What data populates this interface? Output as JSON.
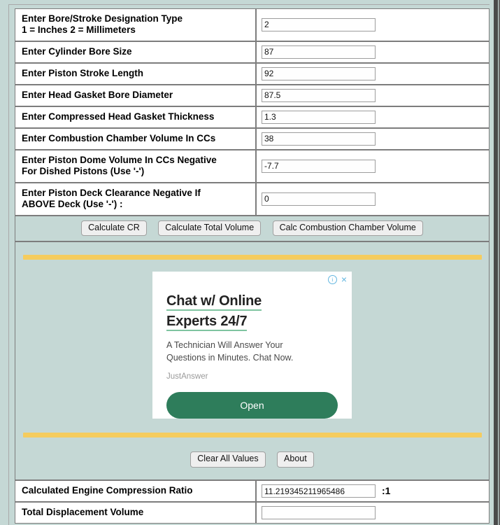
{
  "form": {
    "rows": [
      {
        "label": "Enter Bore/Stroke Designation Type\n1 = Inches 2 = Millimeters",
        "value": "2",
        "name": "bore-stroke-designation-type"
      },
      {
        "label": "Enter Cylinder Bore Size",
        "value": "87",
        "name": "cylinder-bore-size"
      },
      {
        "label": "Enter Piston Stroke Length",
        "value": "92",
        "name": "piston-stroke-length"
      },
      {
        "label": "Enter Head Gasket Bore Diameter",
        "value": "87.5",
        "name": "head-gasket-bore-diameter"
      },
      {
        "label": "Enter Compressed Head Gasket Thickness",
        "value": "1.3",
        "name": "compressed-head-gasket-thickness"
      },
      {
        "label": "Enter Combustion Chamber Volume In CCs",
        "value": "38",
        "name": "combustion-chamber-volume"
      },
      {
        "label": "Enter Piston Dome Volume In CCs Negative\nFor Dished Pistons (Use '-')",
        "value": "-7.7",
        "name": "piston-dome-volume"
      },
      {
        "label": "Enter Piston Deck Clearance Negative If\nABOVE Deck (Use '-') :",
        "value": "0",
        "name": "piston-deck-clearance"
      }
    ]
  },
  "calc_buttons": {
    "calculate_cr": "Calculate CR",
    "calculate_total_volume": "Calculate Total Volume",
    "calc_combustion_chamber_volume": "Calc Combustion Chamber Volume"
  },
  "ad": {
    "headline_line1": "Chat w/ Online",
    "headline_line2": "Experts 24/7",
    "body_line1": "A Technician Will Answer Your",
    "body_line2": "Questions in Minutes. Chat Now.",
    "brand": "JustAnswer",
    "open_label": "Open",
    "info_glyph": "i",
    "close_glyph": "×",
    "info_icon_name": "ad-info-icon",
    "close_icon_name": "ad-close-icon",
    "accent_color": "#2e7d5b",
    "underline_color": "#7fc4a0",
    "control_color": "#62b6e0"
  },
  "bottom_buttons": {
    "clear_all_values": "Clear All Values",
    "about": "About"
  },
  "results": {
    "rows": [
      {
        "label": "Calculated Engine Compression Ratio",
        "value": "11.219345211965486",
        "suffix": ":1",
        "name": "calculated-engine-compression-ratio"
      },
      {
        "label": "Total Displacement Volume",
        "value": "",
        "suffix": "",
        "name": "total-displacement-volume"
      }
    ]
  },
  "theme": {
    "page_background": "#c5d8d5",
    "rule_color": "#f5cc5e",
    "cell_background": "#ffffff",
    "border_color": "#7d7d7d"
  }
}
